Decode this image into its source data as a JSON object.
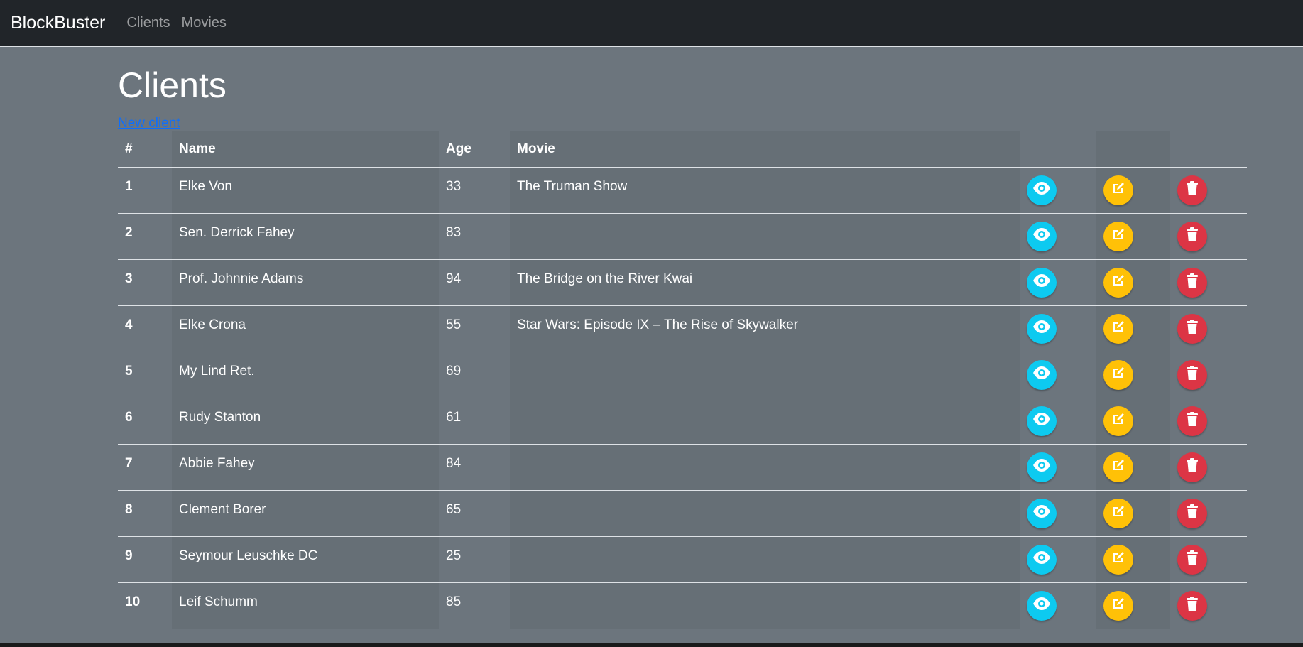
{
  "navbar": {
    "brand": "BlockBuster",
    "links": [
      "Clients",
      "Movies"
    ]
  },
  "page": {
    "title": "Clients",
    "new_link": "New client"
  },
  "table": {
    "headers": [
      "#",
      "Name",
      "Age",
      "Movie"
    ],
    "rows": [
      {
        "id": "1",
        "name": "Elke Von",
        "age": "33",
        "movie": "The Truman Show"
      },
      {
        "id": "2",
        "name": "Sen. Derrick Fahey",
        "age": "83",
        "movie": ""
      },
      {
        "id": "3",
        "name": "Prof. Johnnie Adams",
        "age": "94",
        "movie": "The Bridge on the River Kwai"
      },
      {
        "id": "4",
        "name": "Elke Crona",
        "age": "55",
        "movie": "Star Wars: Episode IX – The Rise of Skywalker"
      },
      {
        "id": "5",
        "name": "My Lind Ret.",
        "age": "69",
        "movie": ""
      },
      {
        "id": "6",
        "name": "Rudy Stanton",
        "age": "61",
        "movie": ""
      },
      {
        "id": "7",
        "name": "Abbie Fahey",
        "age": "84",
        "movie": ""
      },
      {
        "id": "8",
        "name": "Clement Borer",
        "age": "65",
        "movie": ""
      },
      {
        "id": "9",
        "name": "Seymour Leuschke DC",
        "age": "25",
        "movie": ""
      },
      {
        "id": "10",
        "name": "Leif Schumm",
        "age": "85",
        "movie": ""
      }
    ],
    "actions": [
      {
        "icon": "eye-icon",
        "color": "#0dcaf0"
      },
      {
        "icon": "edit-icon",
        "color": "#ffc107"
      },
      {
        "icon": "trash-icon",
        "color": "#dc3545"
      }
    ]
  }
}
